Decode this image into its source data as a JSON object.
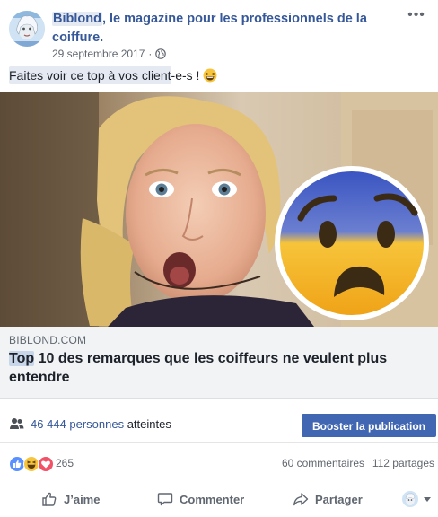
{
  "header": {
    "page_name": "Biblond",
    "title_rest": ", le magazine pour les professionnels de la coiffure.",
    "date": "29 septembre 2017",
    "separator": "·",
    "avatar_icon": "biblond-logo-avatar",
    "privacy_icon": "globe-icon",
    "more_icon": "more-dots-icon"
  },
  "message": {
    "highlighted_text": "Faites voir ce top à vos client",
    "rest_text": "-e-s !",
    "emoji": "grinning-squinting-face-emoji"
  },
  "preview": {
    "image_description_icon": "woman-surprised-photo",
    "emoji_overlay": "anxious-face-with-sweat-emoji",
    "domain": "BIBLOND.COM",
    "title_highlight": "Top",
    "title_rest": " 10 des remarques que les coiffeurs ne veulent plus entendre"
  },
  "reach": {
    "count": "46 444 personnes",
    "suffix": " atteintes",
    "boost_label": "Booster la publication"
  },
  "reactions": {
    "icons": [
      "like-reaction-icon",
      "haha-reaction-icon",
      "love-reaction-icon"
    ],
    "count": "265",
    "comments": "60 commentaires",
    "shares": "112 partages"
  },
  "actions": {
    "like_label": "J’aime",
    "comment_label": "Commenter",
    "share_label": "Partager"
  },
  "colors": {
    "link_blue": "#365899",
    "button_blue": "#4267b2",
    "secondary_text": "#616770",
    "caption_bg": "#f2f3f5"
  }
}
